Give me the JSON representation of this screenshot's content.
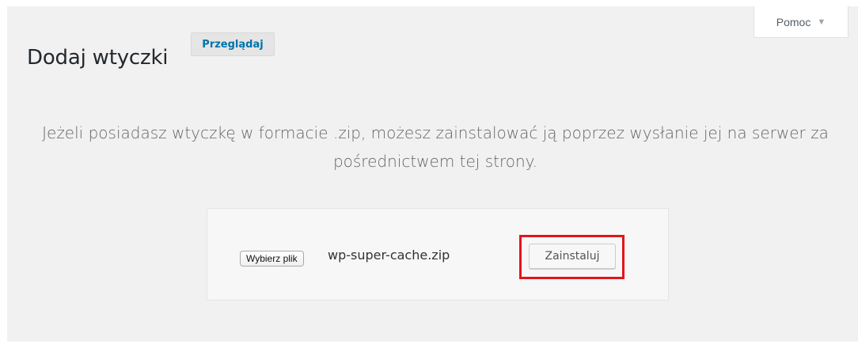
{
  "header": {
    "title": "Dodaj wtyczki",
    "browse_label": "Przeglądaj",
    "help_label": "Pomoc",
    "help_chevron": "▼"
  },
  "upload": {
    "description": "Jeżeli posiadasz wtyczkę w formacie .zip, możesz zainstalować ją poprzez wysłanie jej na serwer za pośrednictwem tej strony.",
    "choose_file_label": "Wybierz plik",
    "file_name": "wp-super-cache.zip",
    "install_label": "Zainstaluj",
    "highlight_color": "#e4141b"
  },
  "colors": {
    "background": "#f1f1f1",
    "link_blue": "#0073aa"
  }
}
